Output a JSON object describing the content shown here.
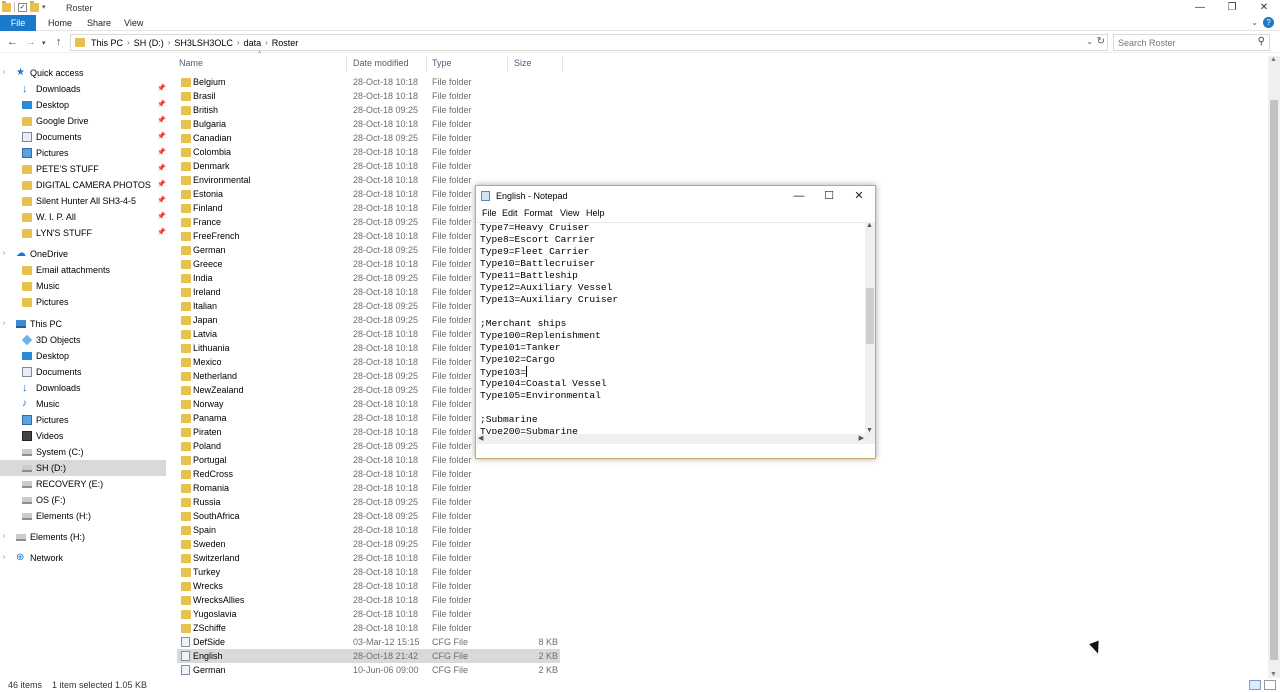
{
  "window": {
    "title": "Roster",
    "minimize": "—",
    "maximize": "❐",
    "close": "✕"
  },
  "ribbon": {
    "file": "File",
    "home": "Home",
    "share": "Share",
    "view": "View"
  },
  "address": {
    "crumbs": [
      "This PC",
      "SH (D:)",
      "SH3LSH3OLC",
      "data",
      "Roster"
    ],
    "search_placeholder": "Search Roster"
  },
  "nav": {
    "quick_access": "Quick access",
    "quick_items": [
      {
        "label": "Downloads",
        "icon": "download-icon"
      },
      {
        "label": "Desktop",
        "icon": "desktop-icon"
      },
      {
        "label": "Google Drive",
        "icon": "folder-icon"
      },
      {
        "label": "Documents",
        "icon": "documents-icon"
      },
      {
        "label": "Pictures",
        "icon": "pictures-icon"
      },
      {
        "label": "PETE'S STUFF",
        "icon": "folder-icon"
      },
      {
        "label": "DIGITAL CAMERA PHOTOS",
        "icon": "folder-icon"
      },
      {
        "label": "Silent Hunter All SH3-4-5",
        "icon": "folder-icon"
      },
      {
        "label": "W. I. P. All",
        "icon": "folder-icon"
      },
      {
        "label": "LYN'S STUFF",
        "icon": "folder-icon"
      }
    ],
    "onedrive": "OneDrive",
    "onedrive_items": [
      {
        "label": "Email attachments"
      },
      {
        "label": "Music"
      },
      {
        "label": "Pictures"
      }
    ],
    "this_pc": "This PC",
    "pc_items": [
      {
        "label": "3D Objects",
        "icon": "3d-objects-icon"
      },
      {
        "label": "Desktop",
        "icon": "desktop-icon"
      },
      {
        "label": "Documents",
        "icon": "documents-icon"
      },
      {
        "label": "Downloads",
        "icon": "download-icon"
      },
      {
        "label": "Music",
        "icon": "music-icon"
      },
      {
        "label": "Pictures",
        "icon": "pictures-icon"
      },
      {
        "label": "Videos",
        "icon": "videos-icon"
      },
      {
        "label": "System (C:)",
        "icon": "drive-icon"
      },
      {
        "label": "SH  (D:)",
        "icon": "drive-icon"
      },
      {
        "label": "RECOVERY (E:)",
        "icon": "drive-icon"
      },
      {
        "label": "OS (F:)",
        "icon": "drive-icon"
      },
      {
        "label": "Elements (H:)",
        "icon": "drive-icon"
      }
    ],
    "elements": "Elements (H:)",
    "network": "Network"
  },
  "columns": {
    "name": "Name",
    "date": "Date modified",
    "type": "Type",
    "size": "Size"
  },
  "files": [
    {
      "name": "Belgium",
      "date": "28-Oct-18 10:18",
      "type": "File folder",
      "size": ""
    },
    {
      "name": "Brasil",
      "date": "28-Oct-18 10:18",
      "type": "File folder",
      "size": ""
    },
    {
      "name": "British",
      "date": "28-Oct-18 09:25",
      "type": "File folder",
      "size": ""
    },
    {
      "name": "Bulgaria",
      "date": "28-Oct-18 10:18",
      "type": "File folder",
      "size": ""
    },
    {
      "name": "Canadian",
      "date": "28-Oct-18 09:25",
      "type": "File folder",
      "size": ""
    },
    {
      "name": "Colombia",
      "date": "28-Oct-18 10:18",
      "type": "File folder",
      "size": ""
    },
    {
      "name": "Denmark",
      "date": "28-Oct-18 10:18",
      "type": "File folder",
      "size": ""
    },
    {
      "name": "Environmental",
      "date": "28-Oct-18 10:18",
      "type": "File folder",
      "size": ""
    },
    {
      "name": "Estonia",
      "date": "28-Oct-18 10:18",
      "type": "File folder",
      "size": ""
    },
    {
      "name": "Finland",
      "date": "28-Oct-18 10:18",
      "type": "File folder",
      "size": ""
    },
    {
      "name": "France",
      "date": "28-Oct-18 09:25",
      "type": "File folder",
      "size": ""
    },
    {
      "name": "FreeFrench",
      "date": "28-Oct-18 10:18",
      "type": "File folder",
      "size": ""
    },
    {
      "name": "German",
      "date": "28-Oct-18 09:25",
      "type": "File folder",
      "size": ""
    },
    {
      "name": "Greece",
      "date": "28-Oct-18 10:18",
      "type": "File folder",
      "size": ""
    },
    {
      "name": "India",
      "date": "28-Oct-18 09:25",
      "type": "File folder",
      "size": ""
    },
    {
      "name": "Ireland",
      "date": "28-Oct-18 10:18",
      "type": "File folder",
      "size": ""
    },
    {
      "name": "Italian",
      "date": "28-Oct-18 09:25",
      "type": "File folder",
      "size": ""
    },
    {
      "name": "Japan",
      "date": "28-Oct-18 09:25",
      "type": "File folder",
      "size": ""
    },
    {
      "name": "Latvia",
      "date": "28-Oct-18 10:18",
      "type": "File folder",
      "size": ""
    },
    {
      "name": "Lithuania",
      "date": "28-Oct-18 10:18",
      "type": "File folder",
      "size": ""
    },
    {
      "name": "Mexico",
      "date": "28-Oct-18 10:18",
      "type": "File folder",
      "size": ""
    },
    {
      "name": "Netherland",
      "date": "28-Oct-18 09:25",
      "type": "File folder",
      "size": ""
    },
    {
      "name": "NewZealand",
      "date": "28-Oct-18 09:25",
      "type": "File folder",
      "size": ""
    },
    {
      "name": "Norway",
      "date": "28-Oct-18 10:18",
      "type": "File folder",
      "size": ""
    },
    {
      "name": "Panama",
      "date": "28-Oct-18 10:18",
      "type": "File folder",
      "size": ""
    },
    {
      "name": "Piraten",
      "date": "28-Oct-18 10:18",
      "type": "File folder",
      "size": ""
    },
    {
      "name": "Poland",
      "date": "28-Oct-18 09:25",
      "type": "File folder",
      "size": ""
    },
    {
      "name": "Portugal",
      "date": "28-Oct-18 10:18",
      "type": "File folder",
      "size": ""
    },
    {
      "name": "RedCross",
      "date": "28-Oct-18 10:18",
      "type": "File folder",
      "size": ""
    },
    {
      "name": "Romania",
      "date": "28-Oct-18 10:18",
      "type": "File folder",
      "size": ""
    },
    {
      "name": "Russia",
      "date": "28-Oct-18 09:25",
      "type": "File folder",
      "size": ""
    },
    {
      "name": "SouthAfrica",
      "date": "28-Oct-18 09:25",
      "type": "File folder",
      "size": ""
    },
    {
      "name": "Spain",
      "date": "28-Oct-18 10:18",
      "type": "File folder",
      "size": ""
    },
    {
      "name": "Sweden",
      "date": "28-Oct-18 09:25",
      "type": "File folder",
      "size": ""
    },
    {
      "name": "Switzerland",
      "date": "28-Oct-18 10:18",
      "type": "File folder",
      "size": ""
    },
    {
      "name": "Turkey",
      "date": "28-Oct-18 10:18",
      "type": "File folder",
      "size": ""
    },
    {
      "name": "Wrecks",
      "date": "28-Oct-18 10:18",
      "type": "File folder",
      "size": ""
    },
    {
      "name": "WrecksAllies",
      "date": "28-Oct-18 10:18",
      "type": "File folder",
      "size": ""
    },
    {
      "name": "Yugoslavia",
      "date": "28-Oct-18 10:18",
      "type": "File folder",
      "size": ""
    },
    {
      "name": "ZSchiffe",
      "date": "28-Oct-18 10:18",
      "type": "File folder",
      "size": ""
    },
    {
      "name": "DefSide",
      "date": "03-Mar-12 15:15",
      "type": "CFG File",
      "size": "8 KB"
    },
    {
      "name": "English",
      "date": "28-Oct-18 21:42",
      "type": "CFG File",
      "size": "2 KB",
      "selected": true
    },
    {
      "name": "German",
      "date": "10-Jun-06 09:00",
      "type": "CFG File",
      "size": "2 KB"
    }
  ],
  "status": {
    "items": "46 items",
    "selected": "1 item selected  1.05 KB"
  },
  "notepad": {
    "title": "English - Notepad",
    "menu": [
      "File",
      "Edit",
      "Format",
      "View",
      "Help"
    ],
    "lines": [
      "Type7=Heavy Cruiser",
      "Type8=Escort Carrier",
      "Type9=Fleet Carrier",
      "Type10=Battlecruiser",
      "Type11=Battleship",
      "Type12=Auxiliary Vessel",
      "Type13=Auxiliary Cruiser",
      "",
      ";Merchant ships",
      "Type100=Replenishment",
      "Type101=Tanker",
      "Type102=Cargo",
      "Type103=",
      "Type104=Coastal Vessel",
      "Type105=Environmental",
      "",
      ";Submarine",
      "Type200=Submarine"
    ]
  }
}
